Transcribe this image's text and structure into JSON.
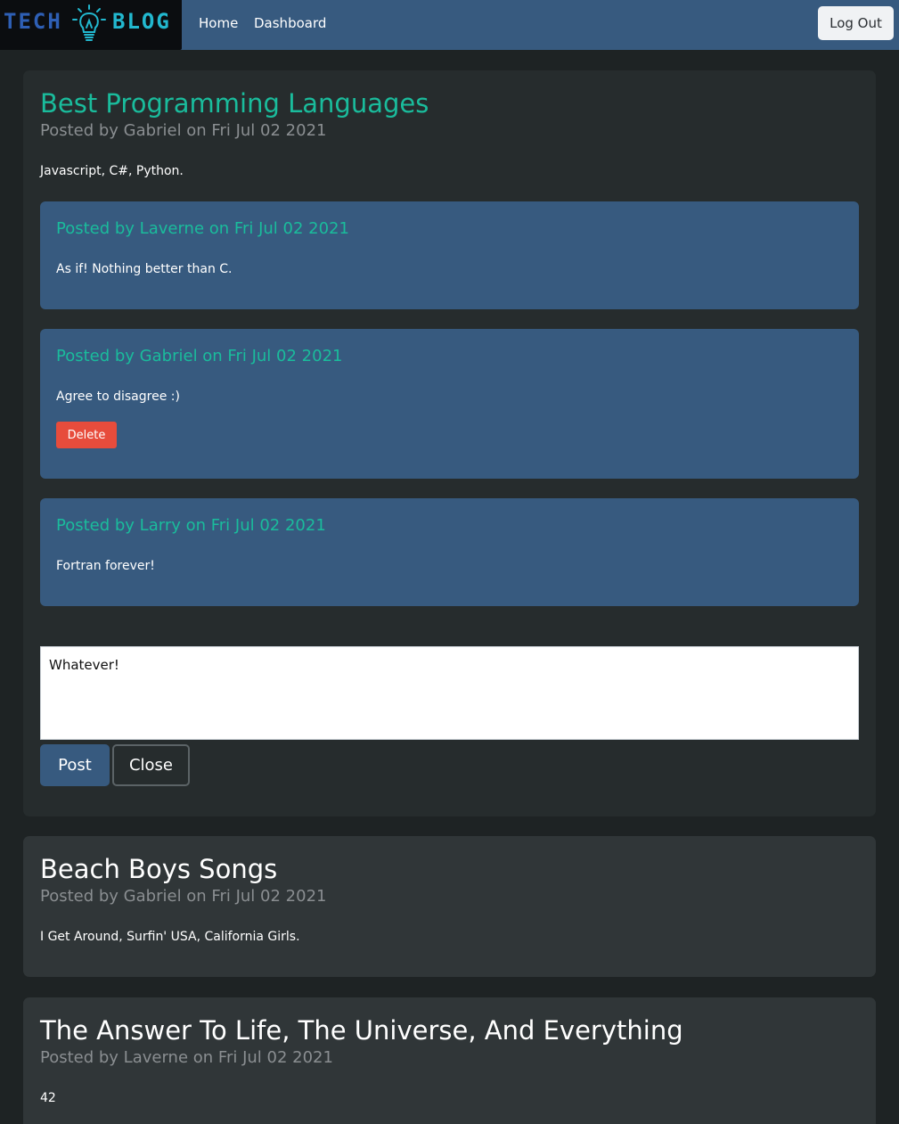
{
  "nav": {
    "logo_left": "TECH",
    "logo_right": "BLOG",
    "home_label": "Home",
    "dashboard_label": "Dashboard",
    "logout_label": "Log Out",
    "brand_color": "#375a7f",
    "accent_color": "#1abc9c",
    "danger_color": "#e74c3c"
  },
  "posts": [
    {
      "title": "Best Programming Languages",
      "meta": "Posted by Gabriel on Fri Jul 02 2021",
      "body": "Javascript, C#, Python.",
      "comments": [
        {
          "meta": "Posted by Laverne on Fri Jul 02 2021",
          "body": "As if! Nothing better than C."
        },
        {
          "meta": "Posted by Gabriel on Fri Jul 02 2021",
          "body": "Agree to disagree :)",
          "delete_label": "Delete"
        },
        {
          "meta": "Posted by Larry on Fri Jul 02 2021",
          "body": "Fortran forever!"
        }
      ],
      "comment_form": {
        "value": "Whatever!",
        "post_label": "Post",
        "close_label": "Close"
      }
    },
    {
      "title": "Beach Boys Songs",
      "meta": "Posted by Gabriel on Fri Jul 02 2021",
      "body": "I Get Around, Surfin' USA, California Girls."
    },
    {
      "title": "The Answer To Life, The Universe, And Everything",
      "meta": "Posted by Laverne on Fri Jul 02 2021",
      "body": "42"
    }
  ]
}
